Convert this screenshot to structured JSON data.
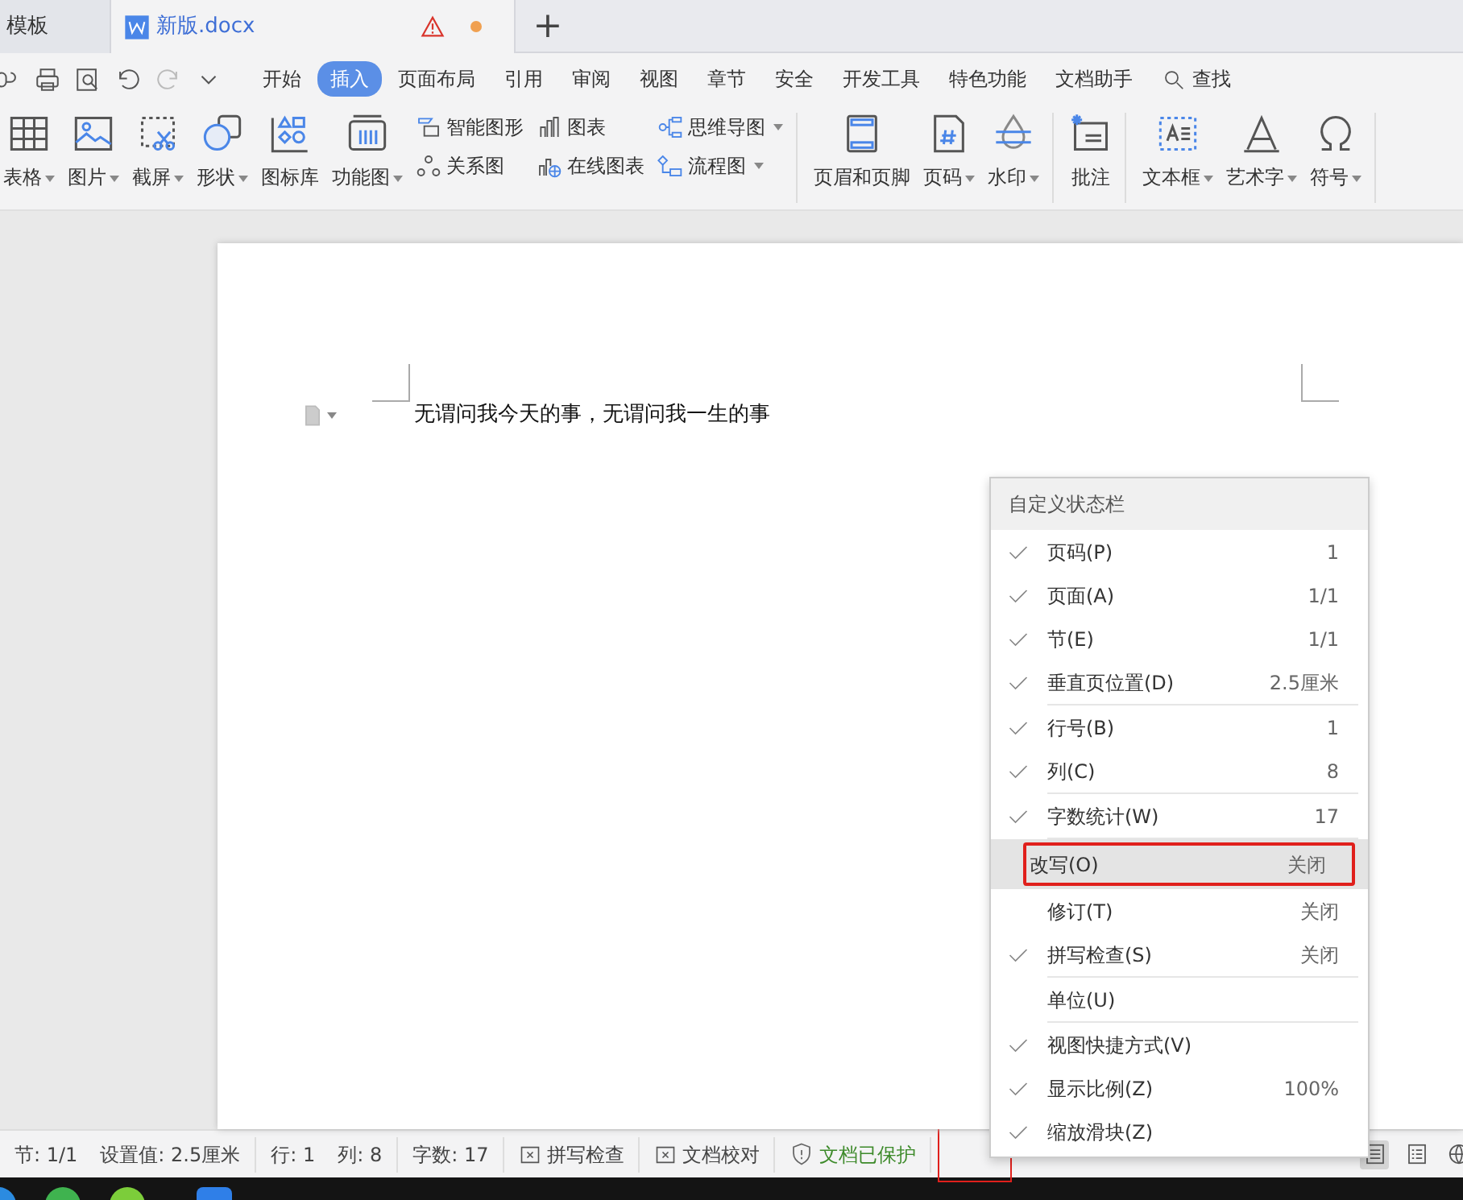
{
  "doc_tabs": [
    {
      "label": "模板",
      "selected": false
    },
    {
      "label": "新版.docx",
      "selected": true,
      "warning": true,
      "unsaved": true
    }
  ],
  "new_tab": "+",
  "menu_tabs": [
    {
      "label": "开始",
      "selected": false
    },
    {
      "label": "插入",
      "selected": true
    },
    {
      "label": "页面布局",
      "selected": false
    },
    {
      "label": "引用",
      "selected": false
    },
    {
      "label": "审阅",
      "selected": false
    },
    {
      "label": "视图",
      "selected": false
    },
    {
      "label": "章节",
      "selected": false
    },
    {
      "label": "安全",
      "selected": false
    },
    {
      "label": "开发工具",
      "selected": false
    },
    {
      "label": "特色功能",
      "selected": false
    },
    {
      "label": "文档助手",
      "selected": false
    }
  ],
  "search": {
    "label": "查找"
  },
  "ribbon": {
    "groups": [
      [
        {
          "kind": "large",
          "label": "表格",
          "dropdown": true
        },
        {
          "kind": "large",
          "label": "图片",
          "dropdown": true
        },
        {
          "kind": "large",
          "label": "截屏",
          "dropdown": true
        },
        {
          "kind": "large",
          "label": "形状",
          "dropdown": true
        },
        {
          "kind": "large",
          "label": "图标库",
          "dropdown": false
        },
        {
          "kind": "large",
          "label": "功能图",
          "dropdown": true
        },
        {
          "kind": "stack",
          "items": [
            {
              "label": "智能图形",
              "dropdown": false
            },
            {
              "label": "关系图",
              "dropdown": false
            }
          ]
        },
        {
          "kind": "stack",
          "items": [
            {
              "label": "图表",
              "dropdown": false
            },
            {
              "label": "在线图表",
              "dropdown": false
            }
          ]
        },
        {
          "kind": "stack",
          "items": [
            {
              "label": "思维导图",
              "dropdown": true
            },
            {
              "label": "流程图",
              "dropdown": true
            }
          ]
        }
      ],
      [
        {
          "kind": "large",
          "label": "页眉和页脚",
          "dropdown": false
        },
        {
          "kind": "large",
          "label": "页码",
          "dropdown": true
        },
        {
          "kind": "large",
          "label": "水印",
          "dropdown": true
        }
      ],
      [
        {
          "kind": "large",
          "label": "批注",
          "dropdown": false
        }
      ],
      [
        {
          "kind": "large",
          "label": "文本框",
          "dropdown": true
        },
        {
          "kind": "large",
          "label": "艺术字",
          "dropdown": true
        },
        {
          "kind": "large",
          "label": "符号",
          "dropdown": true
        }
      ]
    ]
  },
  "document": {
    "text": "无谓问我今天的事，无谓问我一生的事"
  },
  "context_menu": {
    "title": "自定义状态栏",
    "items": [
      {
        "label": "页码(P)",
        "value": "1",
        "checked": true,
        "selected": false,
        "highlighted": false,
        "divider_after": false
      },
      {
        "label": "页面(A)",
        "value": "1/1",
        "checked": true,
        "selected": false,
        "highlighted": false,
        "divider_after": false
      },
      {
        "label": "节(E)",
        "value": "1/1",
        "checked": true,
        "selected": false,
        "highlighted": false,
        "divider_after": false
      },
      {
        "label": "垂直页位置(D)",
        "value": "2.5厘米",
        "checked": true,
        "selected": false,
        "highlighted": false,
        "divider_after": true
      },
      {
        "label": "行号(B)",
        "value": "1",
        "checked": true,
        "selected": false,
        "highlighted": false,
        "divider_after": false
      },
      {
        "label": "列(C)",
        "value": "8",
        "checked": true,
        "selected": false,
        "highlighted": false,
        "divider_after": true
      },
      {
        "label": "字数统计(W)",
        "value": "17",
        "checked": true,
        "selected": false,
        "highlighted": false,
        "divider_after": true
      },
      {
        "label": "改写(O)",
        "value": "关闭",
        "checked": false,
        "selected": true,
        "highlighted": true,
        "divider_after": false
      },
      {
        "label": "修订(T)",
        "value": "关闭",
        "checked": false,
        "selected": false,
        "highlighted": false,
        "divider_after": false
      },
      {
        "label": "拼写检查(S)",
        "value": "关闭",
        "checked": true,
        "selected": false,
        "highlighted": false,
        "divider_after": true
      },
      {
        "label": "单位(U)",
        "checked": false,
        "selected": false,
        "highlighted": false,
        "divider_after": true
      },
      {
        "label": "视图快捷方式(V)",
        "checked": true,
        "selected": false,
        "highlighted": false,
        "divider_after": false
      },
      {
        "label": "显示比例(Z)",
        "value": "100%",
        "checked": true,
        "selected": false,
        "highlighted": false,
        "divider_after": false
      },
      {
        "label": "缩放滑块(Z)",
        "checked": true,
        "selected": false,
        "highlighted": false,
        "divider_after": false
      }
    ]
  },
  "status_bar": {
    "groups": [
      [
        {
          "kind": "text",
          "label": "节: 1/1"
        },
        {
          "kind": "text",
          "label": "设置值: 2.5厘米"
        }
      ],
      [
        {
          "kind": "text",
          "label": "行: 1"
        },
        {
          "kind": "text",
          "label": "列: 8"
        }
      ],
      [
        {
          "kind": "text",
          "label": "字数: 17"
        }
      ],
      [
        {
          "kind": "check",
          "label": "拼写检查"
        }
      ],
      [
        {
          "kind": "check",
          "label": "文档校对"
        }
      ],
      [
        {
          "kind": "protect",
          "label": "文档已保护"
        }
      ]
    ],
    "marked_slot": true,
    "views": [
      {
        "selected": true
      },
      {
        "selected": false
      },
      {
        "selected": false
      }
    ]
  }
}
